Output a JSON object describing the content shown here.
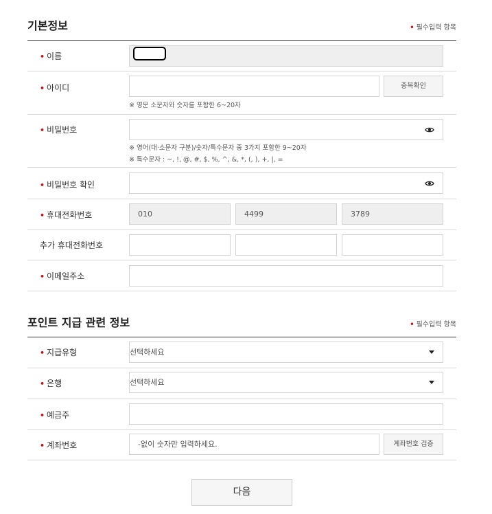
{
  "basic": {
    "title": "기본정보",
    "required_note": "필수입력 항목",
    "name_label": "이름",
    "id_label": "아이디",
    "id_check_button": "중복확인",
    "id_hint": "※ 영문 소문자와 숫자를 포함한 6~20자",
    "password_label": "비밀번호",
    "password_hint1": "※ 영어(대·소문자 구분)/숫자/특수문자 중 3가지 포함한 9~20자",
    "password_hint2": "※ 특수문자 : ~, !, @, #, $, %, ^, &, *, (, ), +, |, =",
    "password_confirm_label": "비밀번호 확인",
    "mobile_label": "휴대전화번호",
    "mobile_1": "010",
    "mobile_2": "4499",
    "mobile_3": "3789",
    "extra_mobile_label": "추가 휴대전화번호",
    "email_label": "이메일주소"
  },
  "point": {
    "title": "포인트 지급 관련 정보",
    "required_note": "필수입력 항목",
    "pay_type_label": "지급유형",
    "pay_type_value": "선택하세요",
    "bank_label": "은행",
    "bank_value": "선택하세요",
    "holder_label": "예금주",
    "account_label": "계좌번호",
    "account_placeholder": "-없이 숫자만 입력하세요.",
    "account_verify_button": "계좌번호 검증"
  },
  "next_button": "다음",
  "icons": {
    "eye": "eye-icon",
    "caret": "caret-down-icon",
    "bullet": "required-dot-icon"
  },
  "colors": {
    "required_dot": "#b3141e",
    "disabled_bg": "#efefef"
  }
}
